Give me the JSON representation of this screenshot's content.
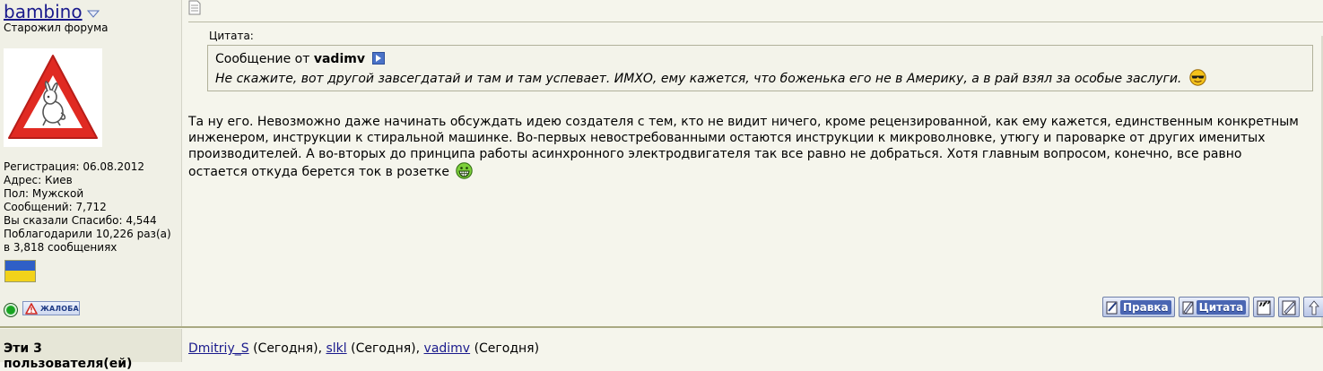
{
  "user": {
    "name": "bambino",
    "title": "Старожил форума",
    "info": [
      "Регистрация: 06.08.2012",
      "Адрес: Киев",
      "Пол: Мужской",
      "Сообщений: 7,712",
      "Вы сказали Спасибо: 4,544",
      "Поблагодарили 10,226 раз(а)",
      "в 3,818 сообщениях"
    ],
    "report_label": "ЖАЛОБА"
  },
  "quote": {
    "label": "Цитата:",
    "from_prefix": "Сообщение от",
    "author": "vadimv",
    "text": "Не скажите, вот другой завсегдатай и там и там успевает. ИМХО, ему кажется, что боженька его не в Америку, а в рай взял за особые заслуги."
  },
  "post": {
    "lines": [
      "Та ну его. Невозможно даже начинать обсуждать идею создателя с тем, кто не видит ничего, кроме рецензированной, как ему кажется, единственным конкретным",
      "инженером, инструкции к стиральной машинке. Во-первых невостребованными остаются инструкции к микроволновке, утюгу и пароварке от других именитых",
      "производителей. А во-вторых до принципа работы асинхронного электродвигателя так все равно не добраться. Хотя главным вопросом, конечно, все равно",
      "остается откуда берется ток в розетке"
    ]
  },
  "actions": {
    "edit_label": "Правка",
    "quote_label": "Цитата"
  },
  "thanks": {
    "title_line1": "Эти 3",
    "title_line2": "пользователя(ей)",
    "users": [
      {
        "name": "Dmitriy_S",
        "when": "(Сегодня)"
      },
      {
        "name": "slkl",
        "when": "(Сегодня)"
      },
      {
        "name": "vadimv",
        "when": "(Сегодня)"
      }
    ]
  },
  "colors": {
    "background": "#f5f5ec",
    "link": "#1a1a8c",
    "flag_blue": "#2f5fc6",
    "flag_yellow": "#f2d21a",
    "online": "#1fae2a"
  }
}
